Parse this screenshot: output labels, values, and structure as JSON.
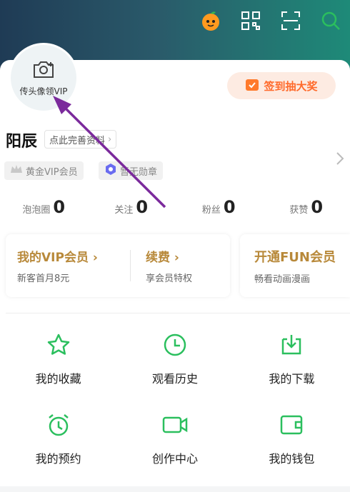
{
  "header": {
    "icons": [
      "orange-mascot-icon",
      "qr-code-icon",
      "scan-icon",
      "search-icon"
    ],
    "brand_color": "#2bbf5e"
  },
  "profile": {
    "avatar_label": "传头像领VIP",
    "signin_label": "签到抽大奖",
    "username": "阳辰",
    "complete_profile": "点此完善资料",
    "badges": [
      {
        "icon": "crown-icon",
        "label": "黄金VIP会员"
      },
      {
        "icon": "hexagon-medal-icon",
        "label": "暂无勋章"
      }
    ]
  },
  "stats": [
    {
      "label": "泡泡圈",
      "value": "0"
    },
    {
      "label": "关注",
      "value": "0"
    },
    {
      "label": "粉丝",
      "value": "0"
    },
    {
      "label": "获赞",
      "value": "0"
    }
  ],
  "vip": {
    "my_vip": "我的VIP会员 ›",
    "my_vip_sub": "新客首月8元",
    "renew": "续费 ›",
    "renew_sub": "享会员特权",
    "fun_title": "开通FUN会员",
    "fun_sub": "畅看动画漫画"
  },
  "grid": [
    {
      "icon": "star-icon",
      "label": "我的收藏"
    },
    {
      "icon": "clock-icon",
      "label": "观看历史"
    },
    {
      "icon": "download-icon",
      "label": "我的下载"
    },
    {
      "icon": "alarm-icon",
      "label": "我的预约"
    },
    {
      "icon": "video-camera-icon",
      "label": "创作中心"
    },
    {
      "icon": "wallet-icon",
      "label": "我的钱包"
    }
  ]
}
